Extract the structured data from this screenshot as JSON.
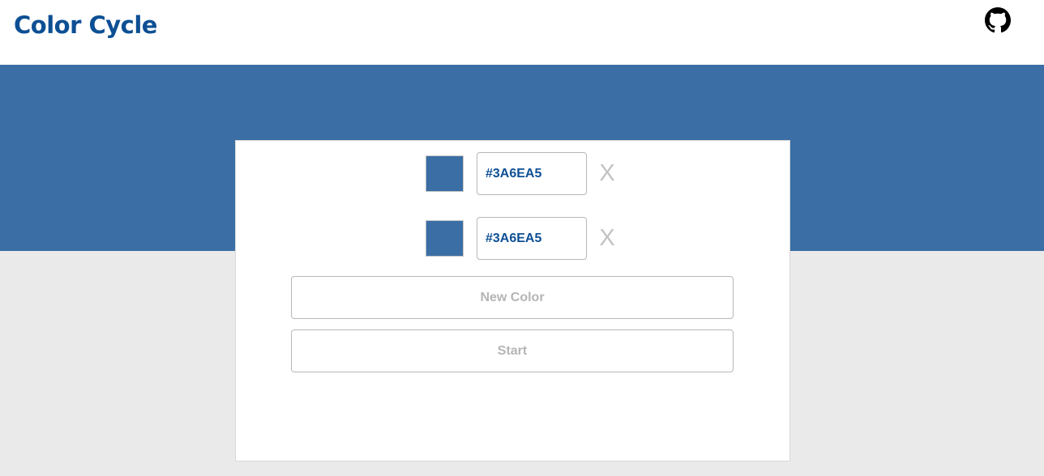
{
  "header": {
    "title": "Color Cycle",
    "github_icon": "github-icon"
  },
  "theme": {
    "accent": "#3A6EA5",
    "title_color": "#0d4f94",
    "page_background": "#eaeaea"
  },
  "colors": [
    {
      "hex": "#3A6EA5",
      "remove_label": "X"
    },
    {
      "hex": "#3A6EA5",
      "remove_label": "X"
    }
  ],
  "actions": {
    "new_color_label": "New Color",
    "start_label": "Start"
  }
}
